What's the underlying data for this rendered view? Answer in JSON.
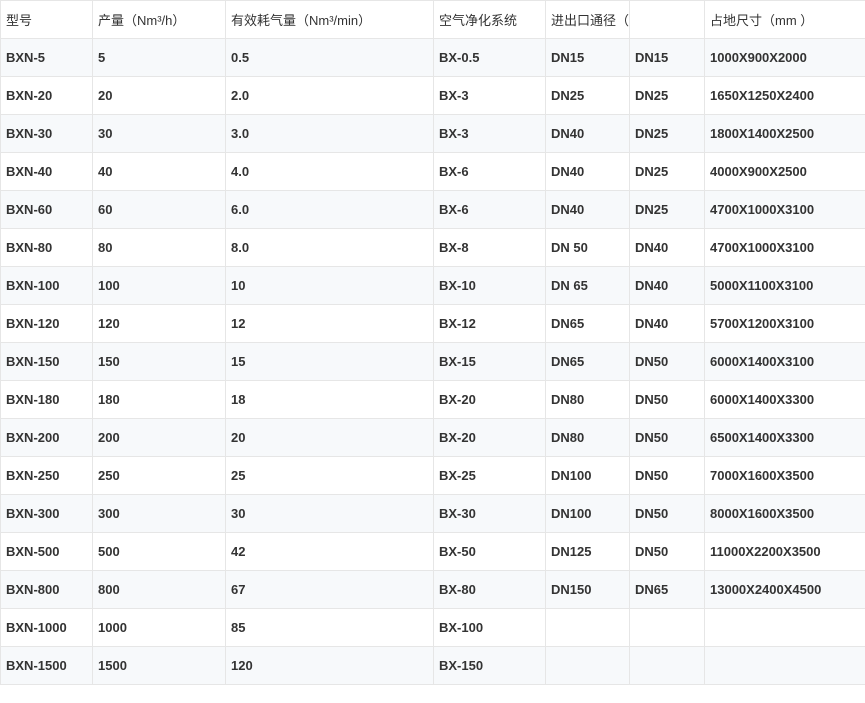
{
  "headers": [
    "型号",
    "产量（Nm³/h）",
    "有效耗气量（Nm³/min）",
    "空气净化系统",
    "进出口通径（mm）",
    "",
    "占地尺寸（mm ）"
  ],
  "rows": [
    [
      "BXN-5",
      "5",
      "0.5",
      "BX-0.5",
      "DN15",
      "DN15",
      "1000X900X2000"
    ],
    [
      "BXN-20",
      "20",
      "2.0",
      "BX-3",
      "DN25",
      "DN25",
      "1650X1250X2400"
    ],
    [
      "BXN-30",
      "30",
      "3.0",
      "BX-3",
      "DN40",
      "DN25",
      "1800X1400X2500"
    ],
    [
      "BXN-40",
      "40",
      "4.0",
      "BX-6",
      "DN40",
      "DN25",
      "4000X900X2500"
    ],
    [
      "BXN-60",
      "60",
      "6.0",
      "BX-6",
      "DN40",
      "DN25",
      "4700X1000X3100"
    ],
    [
      "BXN-80",
      "80",
      "8.0",
      "BX-8",
      "DN 50",
      "DN40",
      "4700X1000X3100"
    ],
    [
      "BXN-100",
      "100",
      "10",
      "BX-10",
      "DN 65",
      "DN40",
      "5000X1100X3100"
    ],
    [
      "BXN-120",
      "120",
      "12",
      "BX-12",
      "DN65",
      "DN40",
      "5700X1200X3100"
    ],
    [
      "BXN-150",
      "150",
      "15",
      "BX-15",
      "DN65",
      "DN50",
      "6000X1400X3100"
    ],
    [
      "BXN-180",
      "180",
      "18",
      "BX-20",
      "DN80",
      "DN50",
      "6000X1400X3300"
    ],
    [
      "BXN-200",
      "200",
      "20",
      "BX-20",
      "DN80",
      "DN50",
      "6500X1400X3300"
    ],
    [
      "BXN-250",
      "250",
      "25",
      "BX-25",
      "DN100",
      "DN50",
      " 7000X1600X3500"
    ],
    [
      "BXN-300",
      "300",
      "30",
      "BX-30",
      "DN100",
      "DN50",
      "8000X1600X3500"
    ],
    [
      "BXN-500",
      "500",
      "42",
      "BX-50",
      "DN125",
      "DN50",
      "11000X2200X3500"
    ],
    [
      "BXN-800",
      "800",
      "67",
      "BX-80",
      "DN150",
      "DN65",
      "13000X2400X4500"
    ],
    [
      "BXN-1000",
      "1000",
      "85",
      "BX-100",
      "",
      "",
      ""
    ],
    [
      "BXN-1500",
      "1500",
      "120",
      "BX-150",
      "",
      "",
      ""
    ]
  ]
}
